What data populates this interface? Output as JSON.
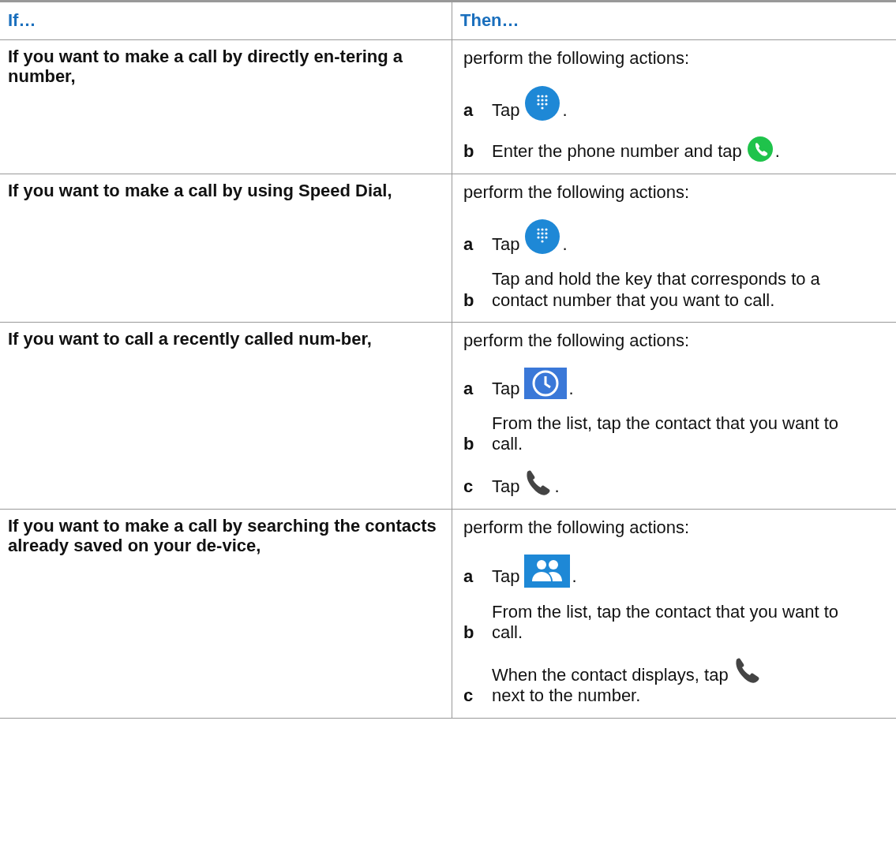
{
  "table": {
    "columns": [
      "If…",
      "Then…"
    ],
    "rows": [
      {
        "condition": "If you want to make a call by directly en-tering a number,",
        "intro": "perform the following actions:",
        "steps": [
          {
            "letter": "a",
            "segments": [
              {
                "kind": "text",
                "text": "Tap"
              },
              {
                "kind": "dialpad"
              },
              {
                "kind": "text",
                "text": "."
              }
            ]
          },
          {
            "letter": "b",
            "segments": [
              {
                "kind": "text",
                "text": "Enter the phone number and tap"
              },
              {
                "kind": "green-call"
              },
              {
                "kind": "text",
                "text": "."
              }
            ]
          }
        ]
      },
      {
        "condition": "If you want to make a call by using Speed Dial,",
        "intro": "perform the following actions:",
        "steps": [
          {
            "letter": "a",
            "segments": [
              {
                "kind": "text",
                "text": "Tap"
              },
              {
                "kind": "dialpad"
              },
              {
                "kind": "text",
                "text": "."
              }
            ]
          },
          {
            "letter": "b",
            "segments": [
              {
                "kind": "text",
                "text": "Tap and hold the key that corresponds to a contact number that you want to call."
              }
            ]
          }
        ]
      },
      {
        "condition": "If you want to call a recently called num-ber,",
        "intro": "perform the following actions:",
        "steps": [
          {
            "letter": "a",
            "segments": [
              {
                "kind": "text",
                "text": "Tap"
              },
              {
                "kind": "clock"
              },
              {
                "kind": "text",
                "text": "."
              }
            ]
          },
          {
            "letter": "b",
            "segments": [
              {
                "kind": "text",
                "text": "From the list, tap the contact that you want to call."
              }
            ]
          },
          {
            "letter": "c",
            "segments": [
              {
                "kind": "text",
                "text": "Tap"
              },
              {
                "kind": "phone"
              },
              {
                "kind": "text",
                "text": "."
              }
            ]
          }
        ]
      },
      {
        "condition": "If you want to make a call by searching the contacts already saved on your de-vice,",
        "intro": "perform the following actions:",
        "steps": [
          {
            "letter": "a",
            "segments": [
              {
                "kind": "text",
                "text": "Tap"
              },
              {
                "kind": "people"
              },
              {
                "kind": "text",
                "text": "."
              }
            ]
          },
          {
            "letter": "b",
            "segments": [
              {
                "kind": "text",
                "text": "From the list, tap the contact that you want to call."
              }
            ]
          },
          {
            "letter": "c",
            "segments": [
              {
                "kind": "text",
                "text": "When the contact displays, tap"
              },
              {
                "kind": "phone"
              },
              {
                "kind": "text",
                "text": "next to the number."
              }
            ]
          }
        ]
      }
    ]
  }
}
